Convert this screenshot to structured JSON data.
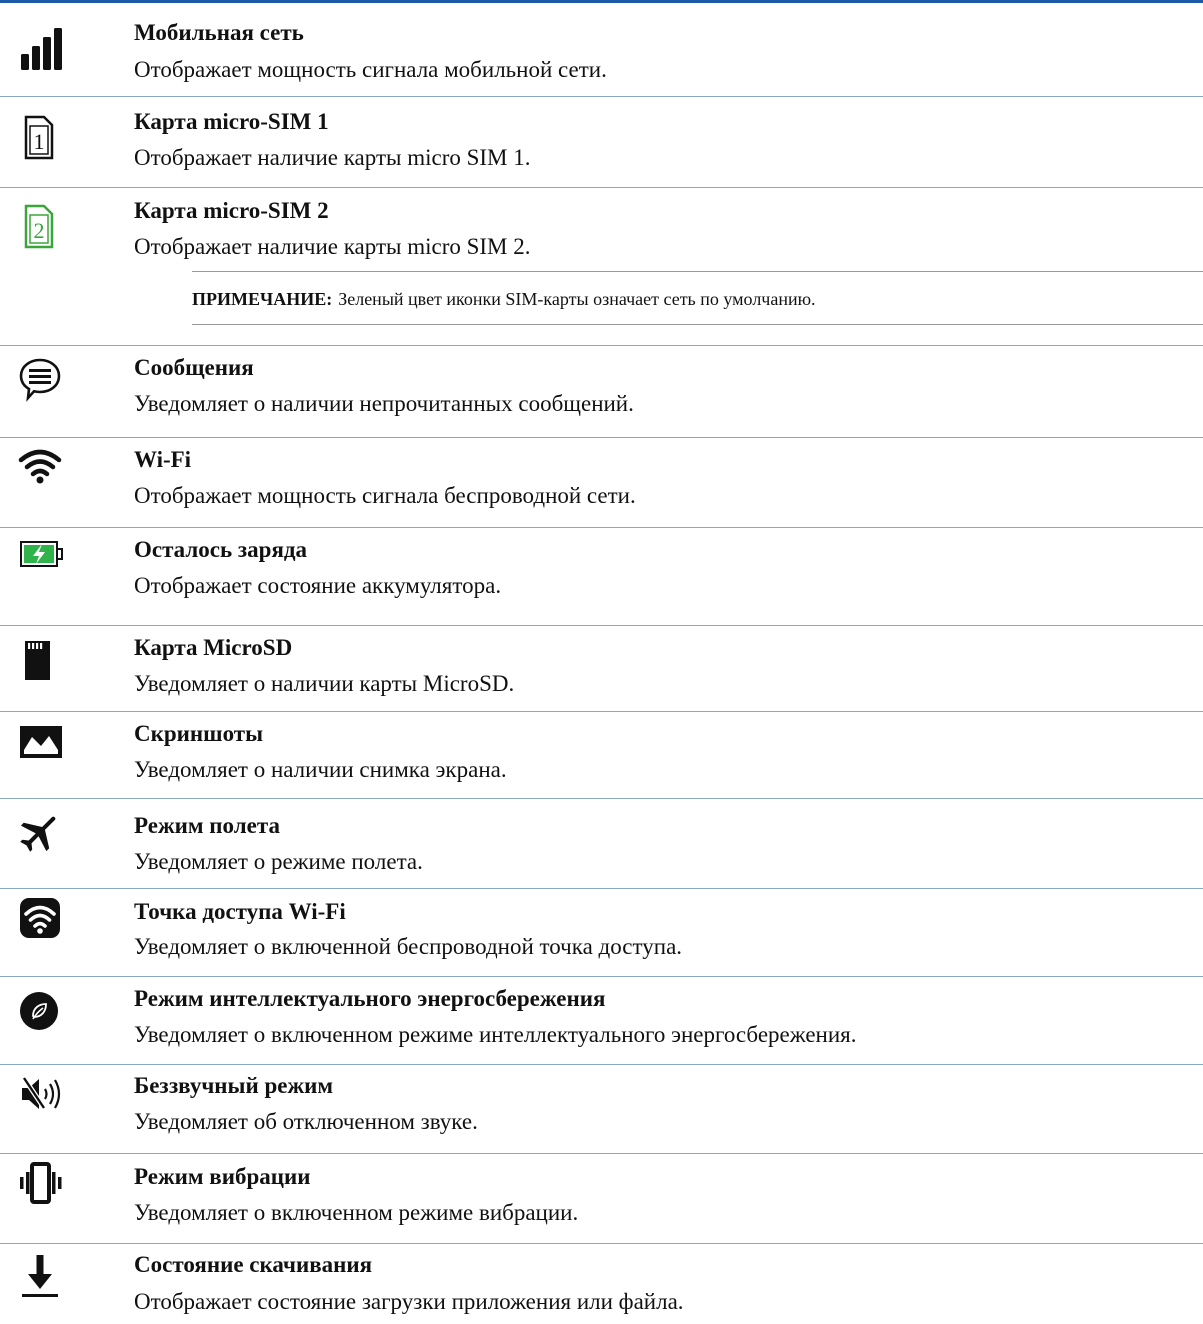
{
  "items": [
    {
      "icon": "cellular-signal-icon",
      "title": "Мобильная сеть",
      "desc": "Отображает мощность сигнала мобильной сети."
    },
    {
      "icon": "sim-1-icon",
      "title": "Карта micro-SIM 1",
      "desc": "Отображает наличие карты micro SIM 1."
    },
    {
      "icon": "sim-2-icon",
      "title": "Карта micro-SIM 2",
      "desc": "Отображает наличие карты micro SIM 2."
    },
    {
      "icon": "messages-icon",
      "title": "Сообщения",
      "desc": "Уведомляет о наличии непрочитанных сообщений."
    },
    {
      "icon": "wifi-icon",
      "title": "Wi-Fi",
      "desc": "Отображает мощность сигнала беспроводной сети."
    },
    {
      "icon": "battery-charging-icon",
      "title": "Осталось заряда",
      "desc": "Отображает состояние аккумулятора."
    },
    {
      "icon": "microsd-card-icon",
      "title": "Карта MicroSD",
      "desc": "Уведомляет о наличии карты MicroSD."
    },
    {
      "icon": "screenshot-icon",
      "title": "Скриншоты",
      "desc": "Уведомляет о наличии снимка экрана."
    },
    {
      "icon": "airplane-icon",
      "title": "Режим полета",
      "desc": "Уведомляет о режиме полета."
    },
    {
      "icon": "wifi-hotspot-icon",
      "title": "Точка доступа Wi-Fi",
      "desc": "Уведомляет о включенной беспроводной точка доступа."
    },
    {
      "icon": "power-saving-icon",
      "title": "Режим интеллектуального энергосбережения",
      "desc": "Уведомляет о включенном режиме интеллектуального энергосбережения."
    },
    {
      "icon": "silent-mode-icon",
      "title": "Беззвучный режим",
      "desc": "Уведомляет об отключенном звуке."
    },
    {
      "icon": "vibration-mode-icon",
      "title": "Режим вибрации",
      "desc": "Уведомляет о включенном режиме вибрации."
    },
    {
      "icon": "download-icon",
      "title": "Состояние скачивания",
      "desc": "Отображает состояние загрузки приложения или файла."
    }
  ],
  "note": {
    "label": "ПРИМЕЧАНИЕ:",
    "text": "Зеленый цвет иконки SIM-карты означает сеть по умолчанию."
  },
  "colors": {
    "accent_rule": "#1e5aa8",
    "separator": "#8aa7c4",
    "sim2_green": "#3aa63a",
    "battery_green": "#2fb34a"
  }
}
